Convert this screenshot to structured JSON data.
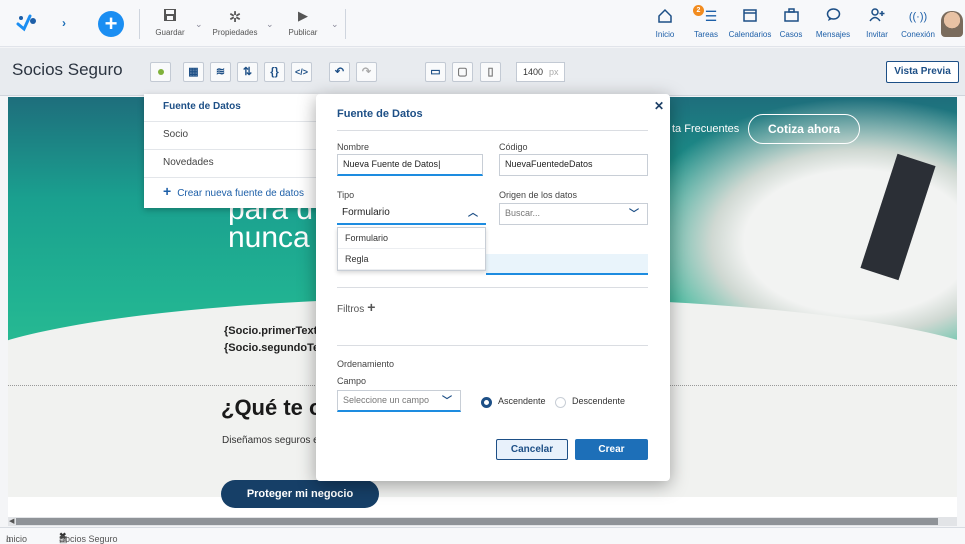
{
  "toolbar": {
    "save_label": "Guardar",
    "properties_label": "Propiedades",
    "publish_label": "Publicar"
  },
  "nav": {
    "home": "Inicio",
    "tasks": "Tareas",
    "tasks_badge": "2",
    "calendars": "Calendarios",
    "cases": "Casos",
    "messages": "Mensajes",
    "invite": "Invitar",
    "connection": "Conexión"
  },
  "editor": {
    "app_title": "Socios Seguro",
    "width_value": "1400",
    "width_unit": "px",
    "preview_button": "Vista Previa"
  },
  "canvas": {
    "menu_link": "ta Frecuentes",
    "cta_button": "Cotiza ahora",
    "hero_line1": "para d",
    "hero_line2": "nunca",
    "var1": "{Socio.primerTexto",
    "var2": "{Socio.segundoTex",
    "heading": "¿Qué te of",
    "paragraph": "Diseñamos seguros e",
    "cta2": "Proteger mi negocio"
  },
  "data_sources_menu": {
    "title": "Fuente de Datos",
    "items": [
      "Socio",
      "Novedades"
    ],
    "create_label": "Crear nueva fuente de datos"
  },
  "modal": {
    "title": "Fuente de Datos",
    "name_label": "Nombre",
    "name_value": "Nueva Fuente de Datos",
    "code_label": "Código",
    "code_value": "NuevaFuentedeDatos",
    "type_label": "Tipo",
    "type_value": "Formulario",
    "type_options": [
      "Formulario",
      "Regla"
    ],
    "origin_label": "Origen de los datos",
    "origin_placeholder": "Buscar...",
    "filters_label": "Filtros",
    "ordering_label": "Ordenamiento",
    "field_label": "Campo",
    "field_placeholder": "Seleccione un campo",
    "asc_label": "Ascendente",
    "desc_label": "Descendente",
    "cancel_button": "Cancelar",
    "create_button": "Crear"
  },
  "statusbar": {
    "home_tab": "Inicio",
    "doc_tab": "Socios Seguro (SociosSeguros)"
  }
}
